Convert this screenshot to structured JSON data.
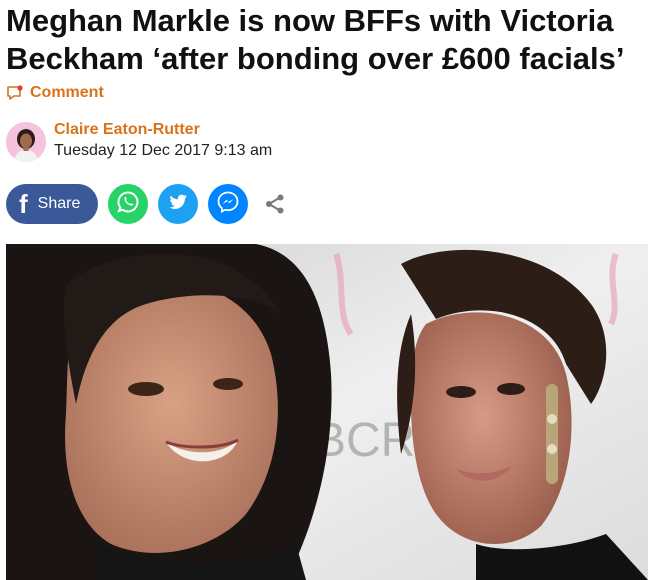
{
  "article": {
    "headline": "Meghan Markle is now BFFs with Victoria Beckham ‘after bonding over £600 facials’",
    "comment_label": "Comment",
    "author_name": "Claire Eaton-Rutter",
    "published": "Tuesday 12 Dec 2017 9:13 am"
  },
  "share": {
    "facebook_label": "Share",
    "icons": [
      "facebook-icon",
      "whatsapp-icon",
      "twitter-icon",
      "messenger-icon",
      "share-icon"
    ]
  },
  "hero_image": {
    "backdrop_text": "BCRF"
  },
  "colors": {
    "accent": "#d9731a",
    "facebook": "#3b5998",
    "whatsapp": "#25d366",
    "twitter": "#1da1f2",
    "messenger": "#0084ff"
  }
}
